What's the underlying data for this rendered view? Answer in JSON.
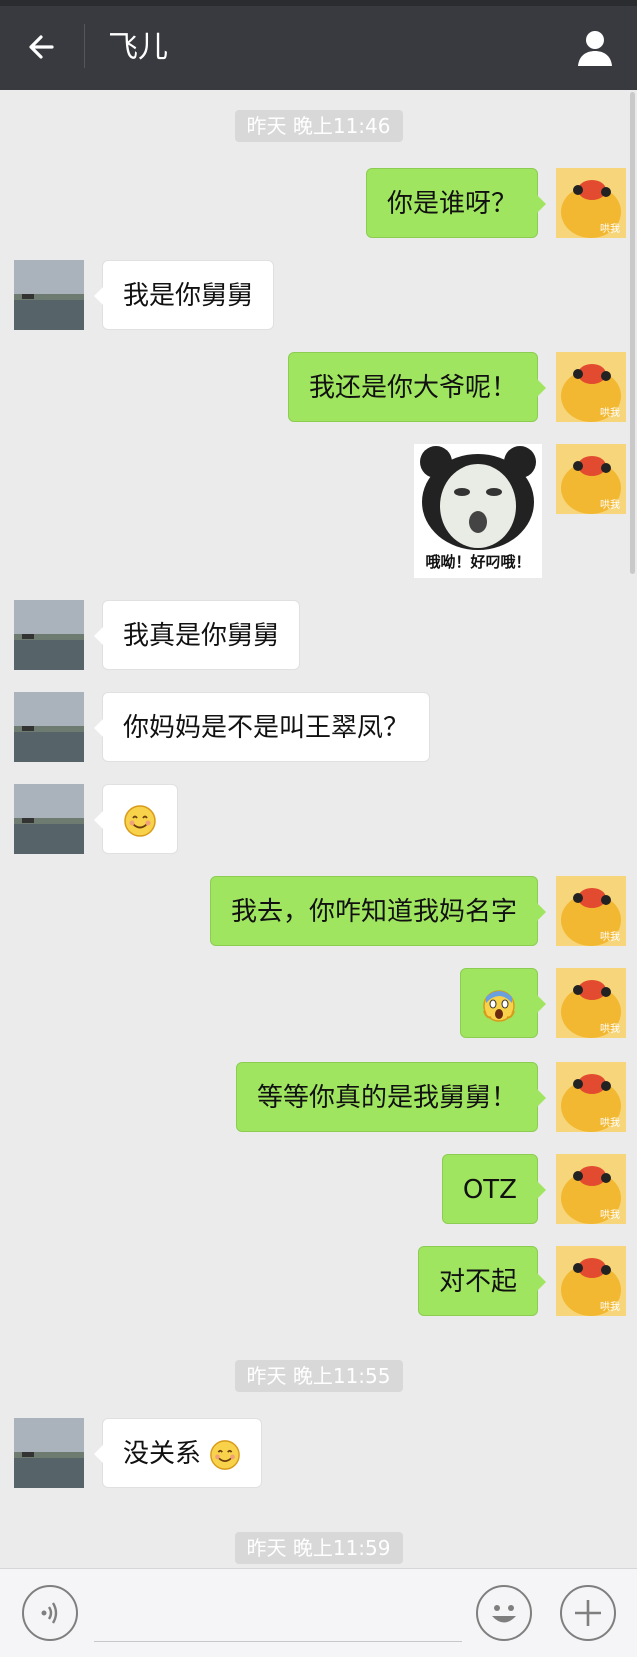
{
  "header": {
    "title": "飞儿"
  },
  "timestamps": [
    "昨天 晚上11:46",
    "昨天 晚上11:55",
    "昨天 晚上11:59"
  ],
  "messages": [
    {
      "side": "right",
      "text": "你是谁呀？"
    },
    {
      "side": "left",
      "text": "我是你舅舅"
    },
    {
      "side": "right",
      "text": "我还是你大爷呢！"
    },
    {
      "side": "right",
      "type": "sticker",
      "caption": "哦呦！好叼哦！"
    },
    {
      "side": "left",
      "text": "我真是你舅舅"
    },
    {
      "side": "left",
      "text": "你妈妈是不是叫王翠凤？"
    },
    {
      "side": "left",
      "type": "emoji",
      "emoji": "smiling-face-icon"
    },
    {
      "side": "right",
      "text": "我去，你咋知道我妈名字"
    },
    {
      "side": "right",
      "type": "emoji",
      "emoji": "screaming-face-icon"
    },
    {
      "side": "right",
      "text": "等等你真的是我舅舅！"
    },
    {
      "side": "right",
      "text": "OTZ"
    },
    {
      "side": "right",
      "text": "对不起"
    },
    {
      "side": "left",
      "text": "没关系",
      "emoji": "smiling-face-icon"
    }
  ],
  "avatar_right_watermark": "哄我",
  "colors": {
    "header": "#393a3f",
    "background": "#ebebeb",
    "bubble_right": "#9fe55f",
    "bubble_left": "#ffffff"
  }
}
